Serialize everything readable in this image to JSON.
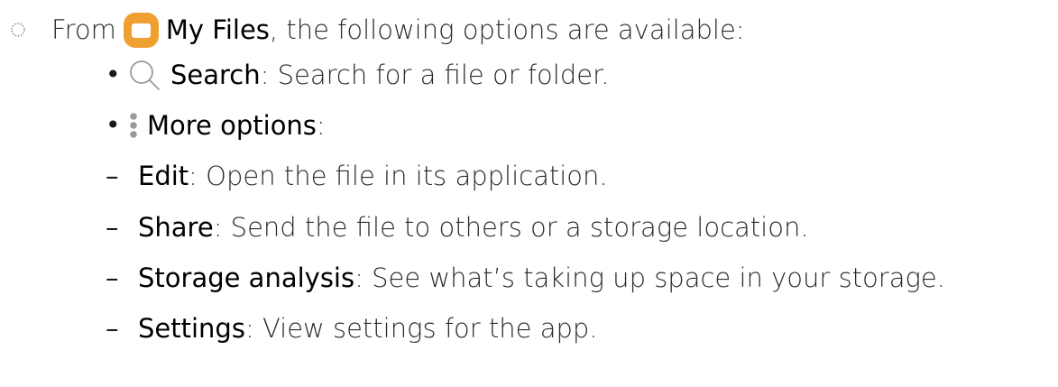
{
  "intro": {
    "before": "From",
    "app_name": "My Files",
    "after": ", the following options are available:"
  },
  "options": [
    {
      "term": "Search",
      "desc": ": Search for a file or folder."
    },
    {
      "term": "More options",
      "desc": ":"
    }
  ],
  "sub_options": [
    {
      "term": "Edit",
      "desc": ": Open the file in its application."
    },
    {
      "term": "Share",
      "desc": ": Send the file to others or a storage location."
    },
    {
      "term": "Storage analysis",
      "desc": ": See what’s taking up space in your storage."
    },
    {
      "term": "Settings",
      "desc": ": View settings for the app."
    }
  ],
  "symbols": {
    "bullet": "•",
    "dash": "–"
  },
  "colors": {
    "app_icon": "#F0A030",
    "icon_gray": "#9a9a9a"
  }
}
